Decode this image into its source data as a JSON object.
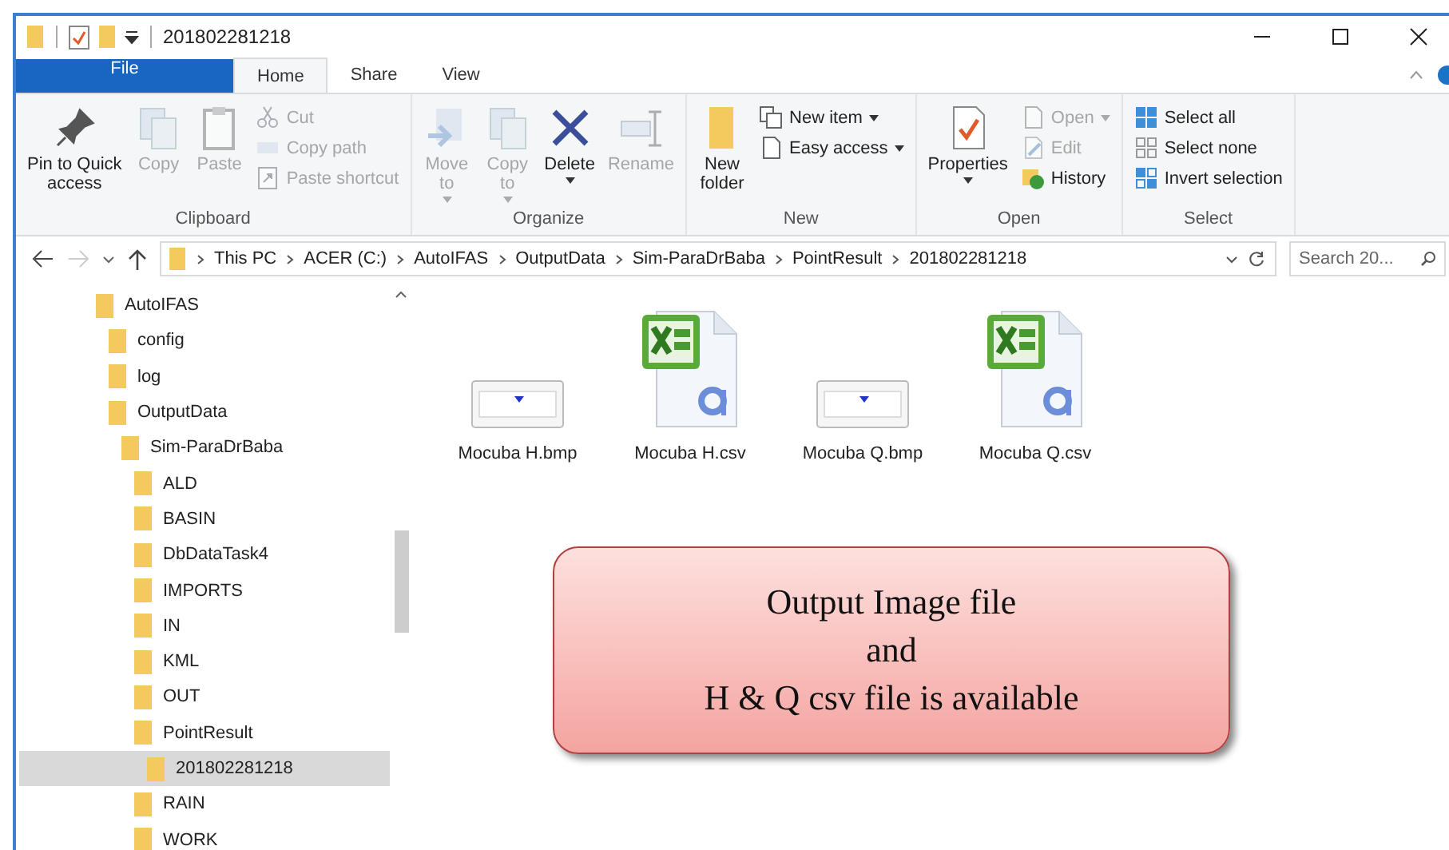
{
  "window": {
    "title": "201802281218"
  },
  "ribbon_tabs": [
    {
      "label": "File",
      "selected": false,
      "kind": "file"
    },
    {
      "label": "Home",
      "selected": true,
      "kind": "tab"
    },
    {
      "label": "Share",
      "selected": false,
      "kind": "tab"
    },
    {
      "label": "View",
      "selected": false,
      "kind": "tab"
    }
  ],
  "ribbon_groups": [
    {
      "label": "Clipboard",
      "items": [
        {
          "kind": "large",
          "label": "Pin to Quick\naccess",
          "disabled": false,
          "dropdown": false
        },
        {
          "kind": "large",
          "label": "Copy",
          "disabled": true,
          "dropdown": false
        },
        {
          "kind": "large",
          "label": "Paste",
          "disabled": true,
          "dropdown": false
        },
        {
          "kind": "small",
          "label": "Cut",
          "disabled": true,
          "dropdown": false
        },
        {
          "kind": "small",
          "label": "Copy path",
          "disabled": true,
          "dropdown": false
        },
        {
          "kind": "small",
          "label": "Paste shortcut",
          "disabled": true,
          "dropdown": false
        }
      ]
    },
    {
      "label": "Organize",
      "items": [
        {
          "kind": "large",
          "label": "Move\nto",
          "disabled": true,
          "dropdown": true
        },
        {
          "kind": "large",
          "label": "Copy\nto",
          "disabled": true,
          "dropdown": true
        },
        {
          "kind": "large",
          "label": "Delete",
          "disabled": false,
          "dropdown": true
        },
        {
          "kind": "large",
          "label": "Rename",
          "disabled": true,
          "dropdown": false
        }
      ]
    },
    {
      "label": "New",
      "items": [
        {
          "kind": "large",
          "label": "New\nfolder",
          "disabled": false,
          "dropdown": false
        },
        {
          "kind": "small",
          "label": "New item",
          "disabled": false,
          "dropdown": true
        },
        {
          "kind": "small",
          "label": "Easy access",
          "disabled": false,
          "dropdown": true
        }
      ]
    },
    {
      "label": "Open",
      "items": [
        {
          "kind": "large",
          "label": "Properties",
          "disabled": false,
          "dropdown": true
        },
        {
          "kind": "small",
          "label": "Open",
          "disabled": true,
          "dropdown": true
        },
        {
          "kind": "small",
          "label": "Edit",
          "disabled": true,
          "dropdown": false
        },
        {
          "kind": "small",
          "label": "History",
          "disabled": false,
          "dropdown": false
        }
      ]
    },
    {
      "label": "Select",
      "items": [
        {
          "kind": "small",
          "label": "Select all",
          "disabled": false,
          "dropdown": false
        },
        {
          "kind": "small",
          "label": "Select none",
          "disabled": false,
          "dropdown": false
        },
        {
          "kind": "small",
          "label": "Invert selection",
          "disabled": false,
          "dropdown": false
        }
      ]
    }
  ],
  "address_bar": {
    "back_disabled": false,
    "forward_disabled": true,
    "path": [
      "This PC",
      "ACER (C:)",
      "AutoIFAS",
      "OutputData",
      "Sim-ParaDrBaba",
      "PointResult",
      "201802281218"
    ],
    "search": {
      "placeholder": "Search 20..."
    }
  },
  "navigation_tree": [
    {
      "label": "AutoIFAS",
      "selected": false,
      "children": [
        {
          "label": "config",
          "selected": false
        },
        {
          "label": "log",
          "selected": false
        },
        {
          "label": "OutputData",
          "selected": false,
          "children": [
            {
              "label": "Sim-ParaDrBaba",
              "selected": false,
              "children": [
                {
                  "label": "ALD",
                  "selected": false
                },
                {
                  "label": "BASIN",
                  "selected": false
                },
                {
                  "label": "DbDataTask4",
                  "selected": false
                },
                {
                  "label": "IMPORTS",
                  "selected": false
                },
                {
                  "label": "IN",
                  "selected": false
                },
                {
                  "label": "KML",
                  "selected": false
                },
                {
                  "label": "OUT",
                  "selected": false
                },
                {
                  "label": "PointResult",
                  "selected": false,
                  "children": [
                    {
                      "label": "201802281218",
                      "selected": true
                    }
                  ]
                },
                {
                  "label": "RAIN",
                  "selected": false
                },
                {
                  "label": "WORK",
                  "selected": false
                }
              ]
            }
          ]
        }
      ]
    }
  ],
  "files": [
    {
      "name": "Mocuba H.bmp",
      "kind": "image"
    },
    {
      "name": "Mocuba H.csv",
      "kind": "spreadsheet"
    },
    {
      "name": "Mocuba Q.bmp",
      "kind": "image"
    },
    {
      "name": "Mocuba Q.csv",
      "kind": "spreadsheet"
    }
  ],
  "callout": {
    "text": "Output Image file\nand\nH & Q csv file is available"
  }
}
